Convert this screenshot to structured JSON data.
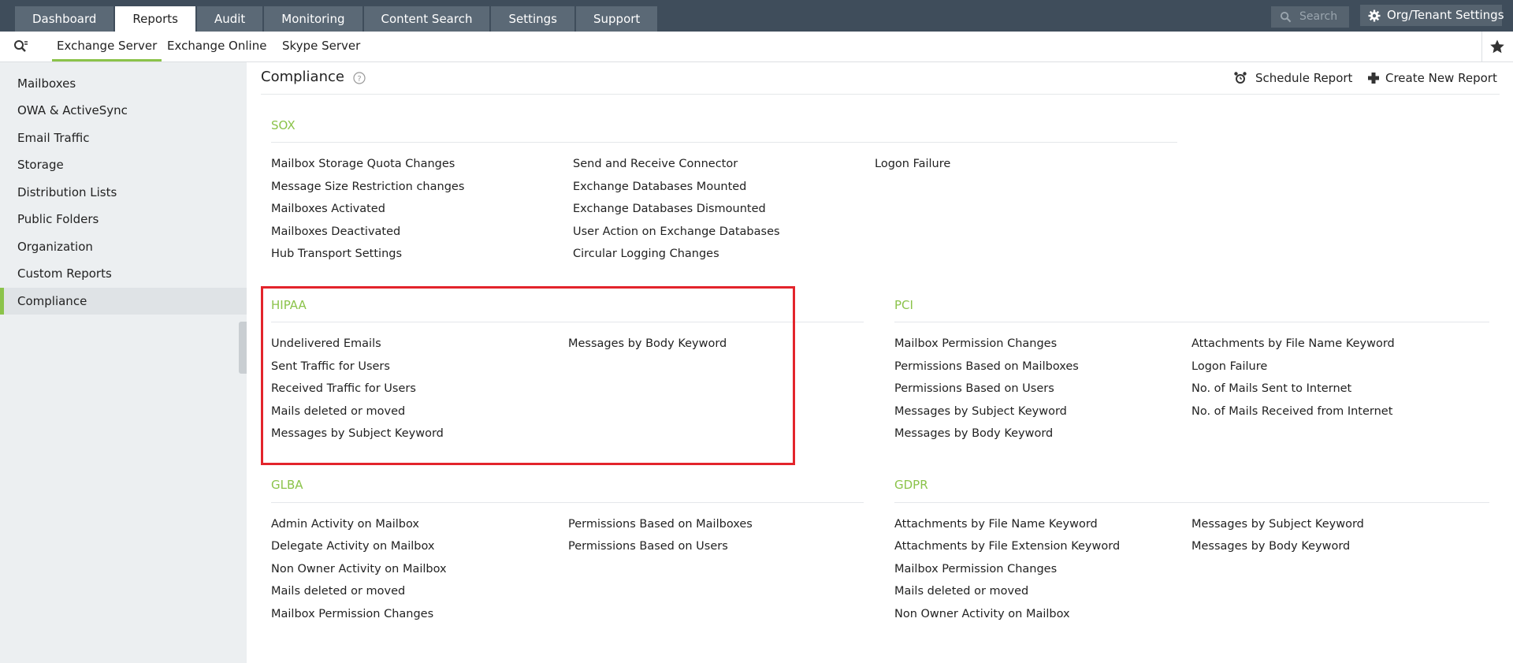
{
  "top_tabs": [
    "Dashboard",
    "Reports",
    "Audit",
    "Monitoring",
    "Content Search",
    "Settings",
    "Support"
  ],
  "active_top_tab": "Reports",
  "search": {
    "placeholder": "Search"
  },
  "org_button": "Org/Tenant Settings",
  "sub_tabs": [
    "Exchange Server",
    "Exchange Online",
    "Skype Server"
  ],
  "active_sub_tab": "Exchange Server",
  "sidebar": {
    "items": [
      "Mailboxes",
      "OWA & ActiveSync",
      "Email Traffic",
      "Storage",
      "Distribution Lists",
      "Public Folders",
      "Organization",
      "Custom Reports",
      "Compliance"
    ],
    "active": "Compliance"
  },
  "main": {
    "title": "Compliance",
    "schedule_report": "Schedule Report",
    "create_new_report": "Create New Report"
  },
  "sections": {
    "sox": {
      "title": "SOX",
      "col1": [
        "Mailbox Storage Quota Changes",
        "Message Size Restriction changes",
        "Mailboxes Activated",
        "Mailboxes Deactivated",
        "Hub Transport Settings"
      ],
      "col2": [
        "Send and Receive Connector",
        "Exchange Databases Mounted",
        "Exchange Databases Dismounted",
        "User Action on Exchange Databases",
        "Circular Logging Changes"
      ],
      "col3": [
        "Logon Failure"
      ]
    },
    "hipaa": {
      "title": "HIPAA",
      "col1": [
        "Undelivered Emails",
        "Sent Traffic for Users",
        "Received Traffic for Users",
        "Mails deleted or moved",
        "Messages by Subject Keyword"
      ],
      "col2": [
        "Messages by Body Keyword"
      ]
    },
    "pci": {
      "title": "PCI",
      "col1": [
        "Mailbox Permission Changes",
        "Permissions Based on Mailboxes",
        "Permissions Based on Users",
        "Messages by Subject Keyword",
        "Messages by Body Keyword"
      ],
      "col2": [
        "Attachments by File Name Keyword",
        "Logon Failure",
        "No. of Mails Sent to Internet",
        "No. of Mails Received from Internet"
      ]
    },
    "glba": {
      "title": "GLBA",
      "col1": [
        "Admin Activity on Mailbox",
        "Delegate Activity on Mailbox",
        "Non Owner Activity on Mailbox",
        "Mails deleted or moved",
        "Mailbox Permission Changes"
      ],
      "col2": [
        "Permissions Based on Mailboxes",
        "Permissions Based on Users"
      ]
    },
    "gdpr": {
      "title": "GDPR",
      "col1": [
        "Attachments by File Name Keyword",
        "Attachments by File Extension Keyword",
        "Mailbox Permission Changes",
        "Mails deleted or moved",
        "Non Owner Activity on Mailbox"
      ],
      "col2": [
        "Messages by Subject Keyword",
        "Messages by Body Keyword"
      ]
    }
  },
  "colors": {
    "accent": "#8bc34a",
    "highlight": "#e3242b",
    "topbar": "#3f4d5b"
  }
}
